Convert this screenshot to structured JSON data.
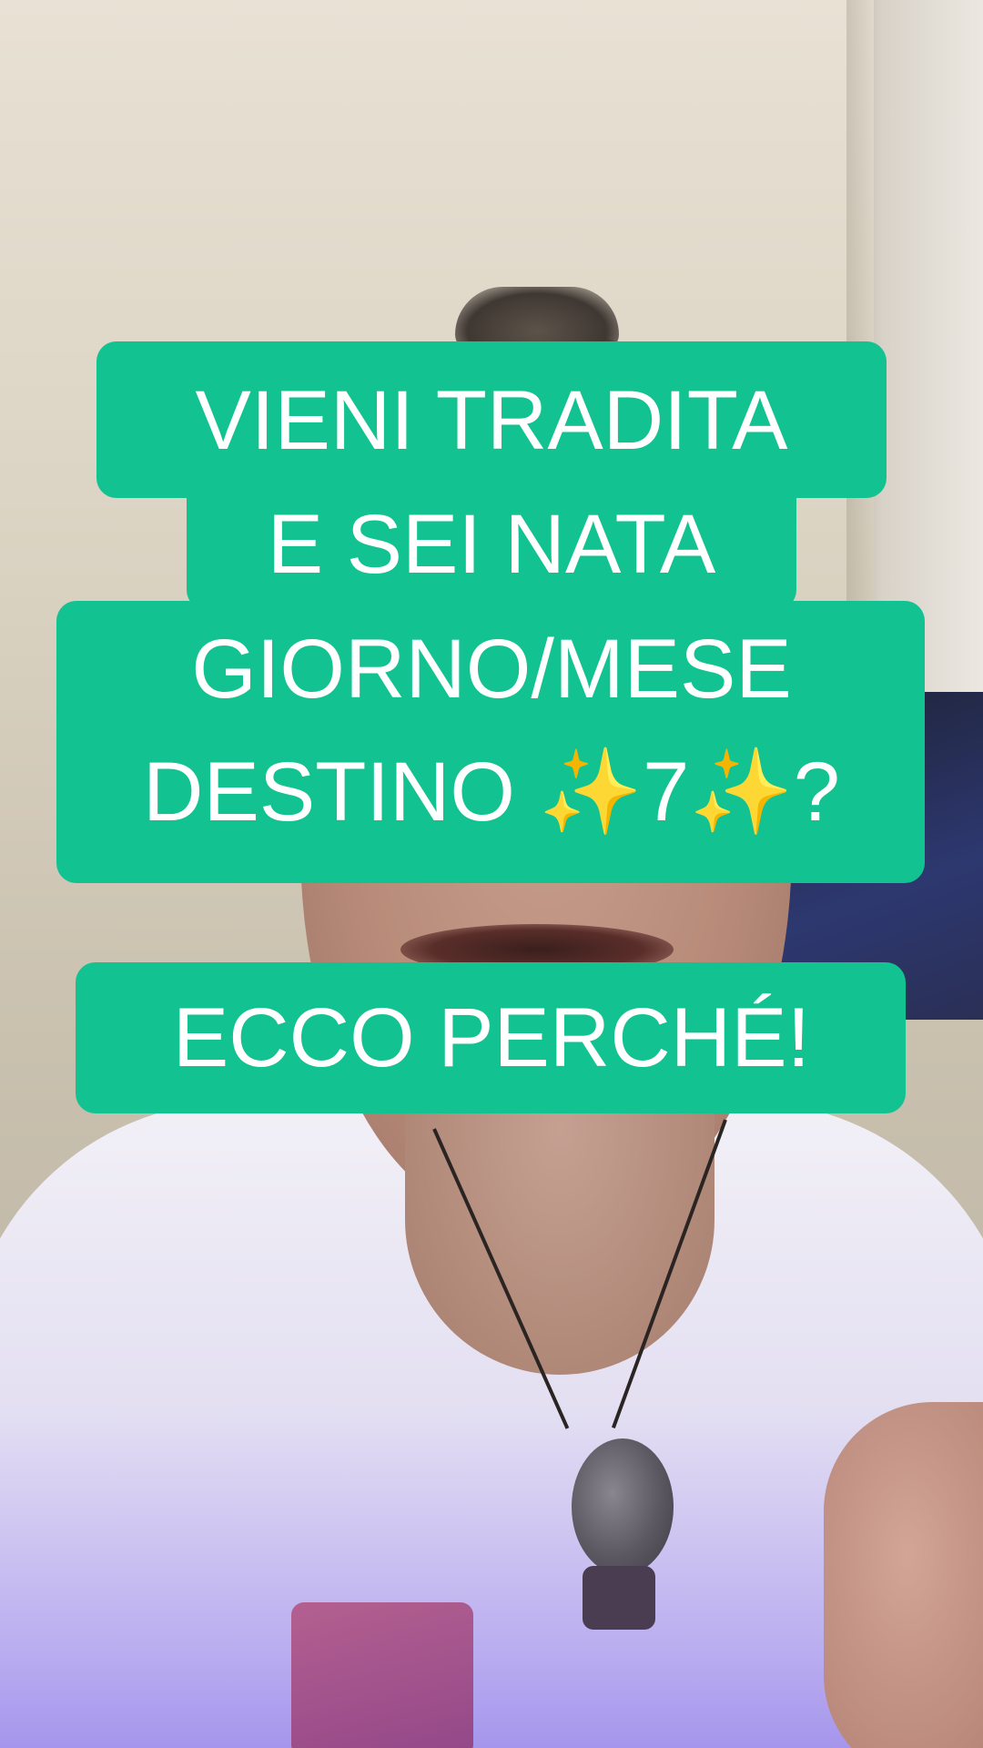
{
  "caption": {
    "lines": [
      "VIENI TRADITA",
      "E SEI NATA",
      "GIORNO/MESE",
      "DESTINO ✨7✨?"
    ],
    "answer": "ECCO PERCHÉ!"
  },
  "colors": {
    "caption_background": "#13c291",
    "caption_text": "#ffffff"
  }
}
